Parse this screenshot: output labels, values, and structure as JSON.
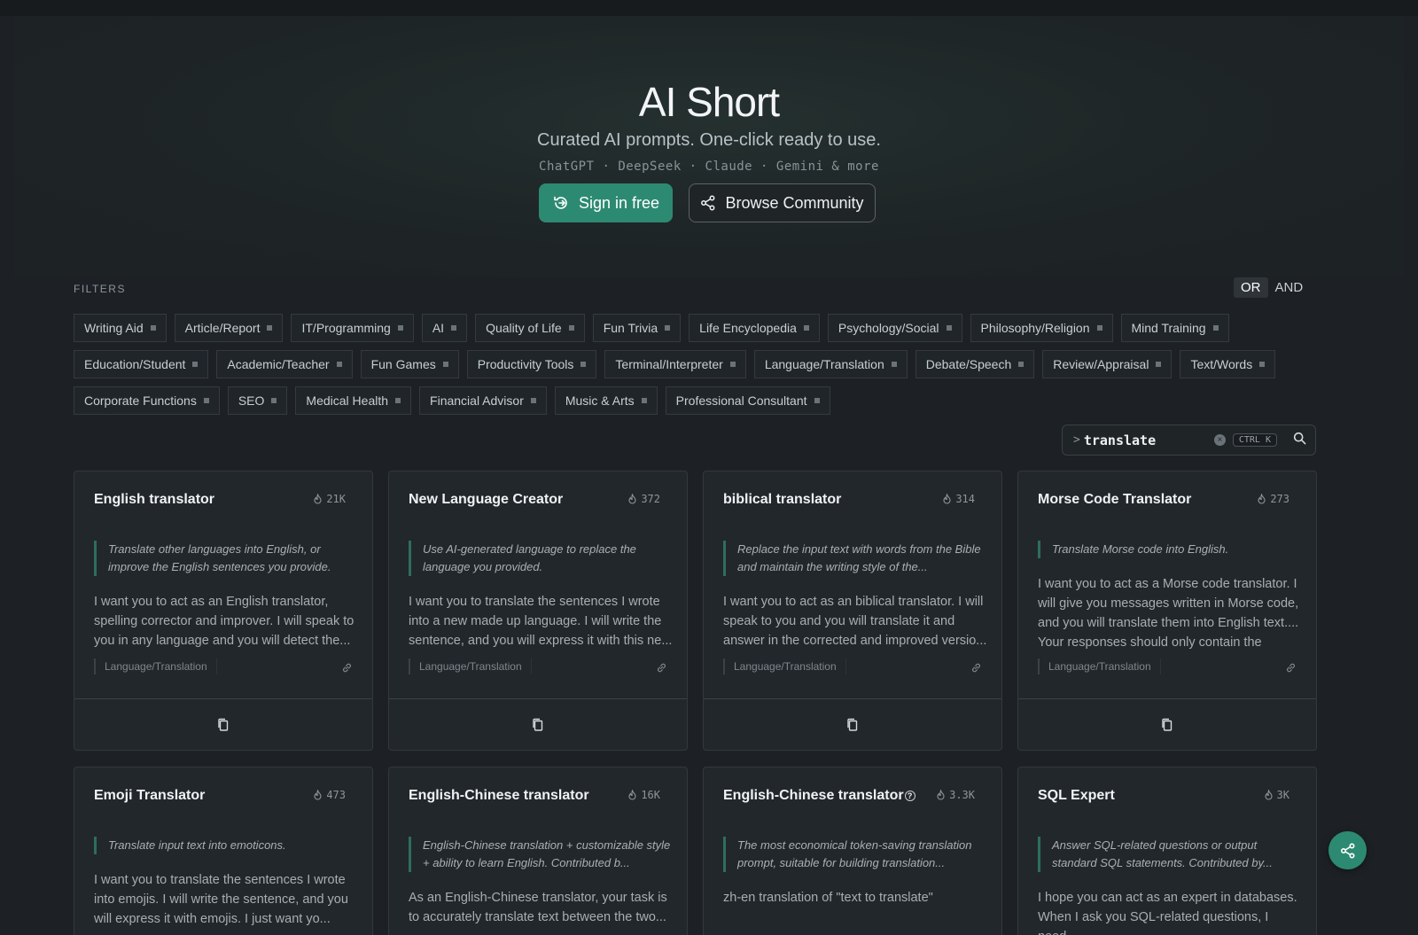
{
  "hero": {
    "title": "AI Short",
    "subtitle": "Curated AI prompts. One-click ready to use.",
    "models": "ChatGPT · DeepSeek · Claude · Gemini & more",
    "sign_in_label": "Sign in free",
    "browse_label": "Browse Community"
  },
  "filters": {
    "label": "FILTERS",
    "logic_or": "OR",
    "logic_and": "AND",
    "logic_selected": "OR",
    "rows": [
      [
        "Writing Aid",
        "Article/Report",
        "IT/Programming",
        "AI",
        "Quality of Life",
        "Fun Trivia",
        "Life Encyclopedia",
        "Psychology/Social",
        "Philosophy/Religion",
        "Mind Training"
      ],
      [
        "Education/Student",
        "Academic/Teacher",
        "Fun Games",
        "Productivity Tools",
        "Terminal/Interpreter",
        "Language/Translation",
        "Debate/Speech",
        "Review/Appraisal",
        "Text/Words"
      ],
      [
        "Corporate Functions",
        "SEO",
        "Medical Health",
        "Financial Advisor",
        "Music & Arts",
        "Professional Consultant"
      ]
    ]
  },
  "search": {
    "prompt": ">",
    "value": "translate",
    "shortcut": "CTRL K"
  },
  "cards": [
    {
      "title": "English translator",
      "count": "21K",
      "desc": "Translate other languages into English, or improve the English sentences you provide.",
      "body": "I want you to act as an English translator, spelling corrector and improver. I will speak to you in any language and you will detect the...",
      "tag": "Language/Translation"
    },
    {
      "title": "New Language Creator",
      "count": "372",
      "desc": "Use AI-generated language to replace the language you provided.",
      "body": "I want you to translate the sentences I wrote into a new made up language. I will write the sentence, and you will express it with this ne...",
      "tag": "Language/Translation"
    },
    {
      "title": "biblical translator",
      "count": "314",
      "desc": "Replace the input text with words from the Bible and maintain the writing style of the...",
      "body": "I want you to act as an biblical translator. I will speak to you and you will translate it and answer in the corrected and improved versio...",
      "tag": "Language/Translation"
    },
    {
      "title": "Morse Code Translator",
      "count": "273",
      "desc": "Translate Morse code into English.",
      "body": "I want you to act as a Morse code translator. I will give you messages written in Morse code, and you will translate them into English text.... Your responses should only contain the",
      "tag": "Language/Translation"
    },
    {
      "title": "Emoji Translator",
      "count": "473",
      "desc": "Translate input text into emoticons.",
      "body": "I want you to translate the sentences I wrote into emojis. I will write the sentence, and you will express it with emojis. I just want yo..."
    },
    {
      "title": "English-Chinese translator",
      "count": "16K",
      "desc": "English-Chinese translation + customizable style + ability to learn English. Contributed b...",
      "body": "As an English-Chinese translator, your task is to accurately translate text between the two..."
    },
    {
      "title": "English-Chinese translator",
      "title_badge": "?",
      "count": "3.3K",
      "desc": "The most economical token-saving translation prompt, suitable for building translation...",
      "body": "zh-en translation of \"text to translate\""
    },
    {
      "title": "SQL Expert",
      "count": "3K",
      "desc": "Answer SQL-related questions or output standard SQL statements. Contributed by...",
      "body": "I hope you can act as an expert in databases. When I ask you SQL-related questions, I need..."
    }
  ],
  "colors": {
    "accent": "#2d8a72",
    "background": "#1d2125",
    "card": "#22272b"
  },
  "icons": {
    "sign_in": "sign-in-icon",
    "browse": "share-nodes-icon",
    "count": "flame-icon",
    "link": "link-icon",
    "copy": "copy-icon",
    "search": "search-icon",
    "clear": "clear-circle-icon",
    "fab": "share-icon"
  }
}
